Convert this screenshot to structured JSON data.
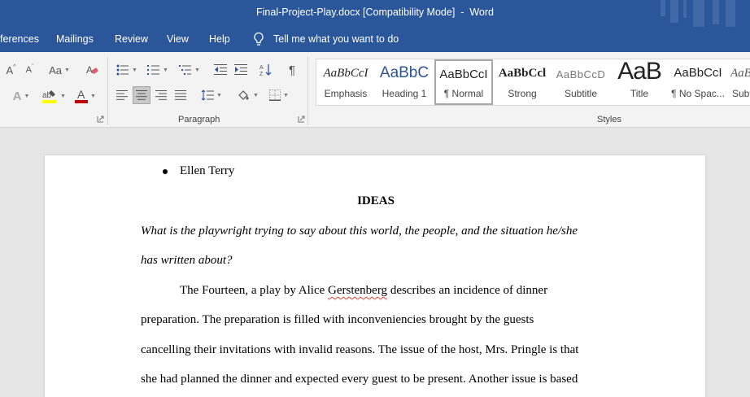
{
  "window": {
    "title": "Final-Project-Play.docx [Compatibility Mode]  -  Word"
  },
  "menu": {
    "tabs": [
      "ferences",
      "Mailings",
      "Review",
      "View",
      "Help"
    ],
    "tell_me": "Tell me what you want to do",
    "tell_me_icon": "lightbulb-icon"
  },
  "ribbon": {
    "groups": {
      "paragraph_label": "Paragraph",
      "styles_label": "Styles"
    },
    "font_buttons": {
      "grow": "A",
      "shrink": "A",
      "change_case": "Aa",
      "text_effects": "A",
      "font_color": "A"
    },
    "colors": {
      "highlight": "#ffff00",
      "font_color": "#c00000",
      "clear_format_accent": "#e05a6a"
    },
    "styles": [
      {
        "preview": "AaBbCcI",
        "name": "Emphasis"
      },
      {
        "preview": "AaBbC",
        "name": "Heading 1"
      },
      {
        "preview": "AaBbCcI",
        "name": "¶ Normal"
      },
      {
        "preview": "AaBbCcl",
        "name": "Strong"
      },
      {
        "preview": "AaBbCcD",
        "name": "Subtitle"
      },
      {
        "preview": "AaB",
        "name": "Title"
      },
      {
        "preview": "AaBbCcI",
        "name": "¶ No Spac..."
      },
      {
        "preview": "AaBl",
        "name": "Subt"
      }
    ],
    "selected_style": "¶ Normal"
  },
  "document": {
    "bullet": "Ellen Terry",
    "heading": "IDEAS",
    "question_line1": "What is the playwright trying to say about this world, the people, and the situation he/she",
    "question_line2": "has written about?",
    "para_line1_a": "The Fourteen, a play by Alice ",
    "para_line1_b": "Gerstenberg",
    "para_line1_c": " describes an incidence of dinner",
    "para_line2": "preparation. The preparation is filled with inconveniencies brought by the guests",
    "para_line3": "cancelling their invitations with invalid reasons. The issue of the host, Mrs. Pringle is that",
    "para_line4": "she had planned the dinner and expected every guest to be present. Another issue is based"
  }
}
